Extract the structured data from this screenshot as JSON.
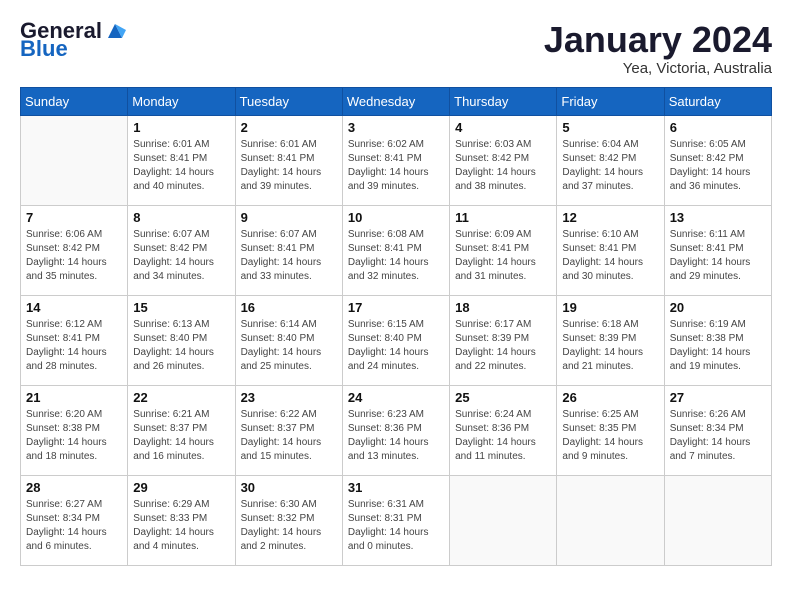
{
  "header": {
    "logo_general": "General",
    "logo_blue": "Blue",
    "month_title": "January 2024",
    "location": "Yea, Victoria, Australia"
  },
  "days_of_week": [
    "Sunday",
    "Monday",
    "Tuesday",
    "Wednesday",
    "Thursday",
    "Friday",
    "Saturday"
  ],
  "weeks": [
    [
      {
        "day": "",
        "info": ""
      },
      {
        "day": "1",
        "info": "Sunrise: 6:01 AM\nSunset: 8:41 PM\nDaylight: 14 hours\nand 40 minutes."
      },
      {
        "day": "2",
        "info": "Sunrise: 6:01 AM\nSunset: 8:41 PM\nDaylight: 14 hours\nand 39 minutes."
      },
      {
        "day": "3",
        "info": "Sunrise: 6:02 AM\nSunset: 8:41 PM\nDaylight: 14 hours\nand 39 minutes."
      },
      {
        "day": "4",
        "info": "Sunrise: 6:03 AM\nSunset: 8:42 PM\nDaylight: 14 hours\nand 38 minutes."
      },
      {
        "day": "5",
        "info": "Sunrise: 6:04 AM\nSunset: 8:42 PM\nDaylight: 14 hours\nand 37 minutes."
      },
      {
        "day": "6",
        "info": "Sunrise: 6:05 AM\nSunset: 8:42 PM\nDaylight: 14 hours\nand 36 minutes."
      }
    ],
    [
      {
        "day": "7",
        "info": "Sunrise: 6:06 AM\nSunset: 8:42 PM\nDaylight: 14 hours\nand 35 minutes."
      },
      {
        "day": "8",
        "info": "Sunrise: 6:07 AM\nSunset: 8:42 PM\nDaylight: 14 hours\nand 34 minutes."
      },
      {
        "day": "9",
        "info": "Sunrise: 6:07 AM\nSunset: 8:41 PM\nDaylight: 14 hours\nand 33 minutes."
      },
      {
        "day": "10",
        "info": "Sunrise: 6:08 AM\nSunset: 8:41 PM\nDaylight: 14 hours\nand 32 minutes."
      },
      {
        "day": "11",
        "info": "Sunrise: 6:09 AM\nSunset: 8:41 PM\nDaylight: 14 hours\nand 31 minutes."
      },
      {
        "day": "12",
        "info": "Sunrise: 6:10 AM\nSunset: 8:41 PM\nDaylight: 14 hours\nand 30 minutes."
      },
      {
        "day": "13",
        "info": "Sunrise: 6:11 AM\nSunset: 8:41 PM\nDaylight: 14 hours\nand 29 minutes."
      }
    ],
    [
      {
        "day": "14",
        "info": "Sunrise: 6:12 AM\nSunset: 8:41 PM\nDaylight: 14 hours\nand 28 minutes."
      },
      {
        "day": "15",
        "info": "Sunrise: 6:13 AM\nSunset: 8:40 PM\nDaylight: 14 hours\nand 26 minutes."
      },
      {
        "day": "16",
        "info": "Sunrise: 6:14 AM\nSunset: 8:40 PM\nDaylight: 14 hours\nand 25 minutes."
      },
      {
        "day": "17",
        "info": "Sunrise: 6:15 AM\nSunset: 8:40 PM\nDaylight: 14 hours\nand 24 minutes."
      },
      {
        "day": "18",
        "info": "Sunrise: 6:17 AM\nSunset: 8:39 PM\nDaylight: 14 hours\nand 22 minutes."
      },
      {
        "day": "19",
        "info": "Sunrise: 6:18 AM\nSunset: 8:39 PM\nDaylight: 14 hours\nand 21 minutes."
      },
      {
        "day": "20",
        "info": "Sunrise: 6:19 AM\nSunset: 8:38 PM\nDaylight: 14 hours\nand 19 minutes."
      }
    ],
    [
      {
        "day": "21",
        "info": "Sunrise: 6:20 AM\nSunset: 8:38 PM\nDaylight: 14 hours\nand 18 minutes."
      },
      {
        "day": "22",
        "info": "Sunrise: 6:21 AM\nSunset: 8:37 PM\nDaylight: 14 hours\nand 16 minutes."
      },
      {
        "day": "23",
        "info": "Sunrise: 6:22 AM\nSunset: 8:37 PM\nDaylight: 14 hours\nand 15 minutes."
      },
      {
        "day": "24",
        "info": "Sunrise: 6:23 AM\nSunset: 8:36 PM\nDaylight: 14 hours\nand 13 minutes."
      },
      {
        "day": "25",
        "info": "Sunrise: 6:24 AM\nSunset: 8:36 PM\nDaylight: 14 hours\nand 11 minutes."
      },
      {
        "day": "26",
        "info": "Sunrise: 6:25 AM\nSunset: 8:35 PM\nDaylight: 14 hours\nand 9 minutes."
      },
      {
        "day": "27",
        "info": "Sunrise: 6:26 AM\nSunset: 8:34 PM\nDaylight: 14 hours\nand 7 minutes."
      }
    ],
    [
      {
        "day": "28",
        "info": "Sunrise: 6:27 AM\nSunset: 8:34 PM\nDaylight: 14 hours\nand 6 minutes."
      },
      {
        "day": "29",
        "info": "Sunrise: 6:29 AM\nSunset: 8:33 PM\nDaylight: 14 hours\nand 4 minutes."
      },
      {
        "day": "30",
        "info": "Sunrise: 6:30 AM\nSunset: 8:32 PM\nDaylight: 14 hours\nand 2 minutes."
      },
      {
        "day": "31",
        "info": "Sunrise: 6:31 AM\nSunset: 8:31 PM\nDaylight: 14 hours\nand 0 minutes."
      },
      {
        "day": "",
        "info": ""
      },
      {
        "day": "",
        "info": ""
      },
      {
        "day": "",
        "info": ""
      }
    ]
  ]
}
